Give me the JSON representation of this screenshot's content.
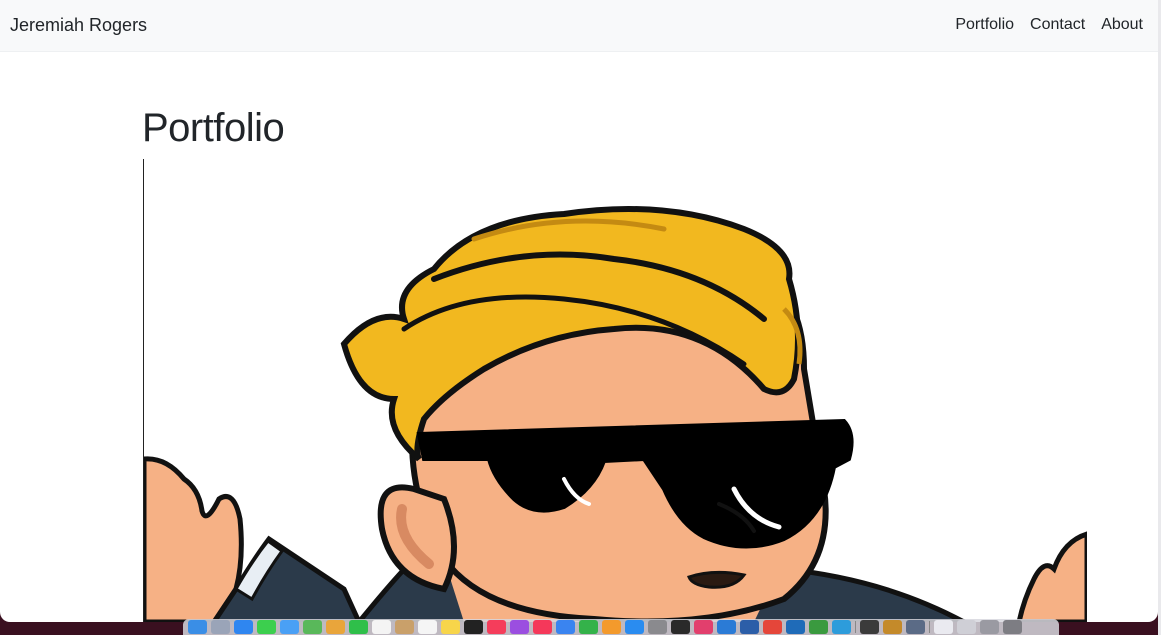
{
  "navbar": {
    "brand": "Jeremiah Rogers",
    "links": [
      {
        "label": "Portfolio"
      },
      {
        "label": "Contact"
      },
      {
        "label": "About"
      }
    ]
  },
  "main": {
    "title": "Portfolio"
  },
  "colors": {
    "navbar_bg": "#f8f9fa",
    "text": "#212529",
    "hair": "#f2b81f",
    "skin": "#f6b185",
    "glasses": "#000000"
  },
  "dock": {
    "icons": [
      {
        "name": "finder-icon",
        "color": "#3a8ee6"
      },
      {
        "name": "launchpad-icon",
        "color": "#9aa4b8"
      },
      {
        "name": "safari-icon",
        "color": "#2f86f0"
      },
      {
        "name": "messages-icon",
        "color": "#3ccf4e"
      },
      {
        "name": "mail-icon",
        "color": "#4aa0f5"
      },
      {
        "name": "maps-icon",
        "color": "#59b85a"
      },
      {
        "name": "photos-icon",
        "color": "#e9a53b"
      },
      {
        "name": "facetime-icon",
        "color": "#2fbf4a"
      },
      {
        "name": "calendar-icon",
        "color": "#f4f4f4"
      },
      {
        "name": "contacts-icon",
        "color": "#c9a06a"
      },
      {
        "name": "reminders-icon",
        "color": "#f5f5f5"
      },
      {
        "name": "notes-icon",
        "color": "#f7d54a"
      },
      {
        "name": "tv-icon",
        "color": "#222222"
      },
      {
        "name": "music-icon",
        "color": "#f53d5b"
      },
      {
        "name": "podcasts-icon",
        "color": "#9b4ee0"
      },
      {
        "name": "news-icon",
        "color": "#f5385a"
      },
      {
        "name": "keynote-icon",
        "color": "#3a84f0"
      },
      {
        "name": "numbers-icon",
        "color": "#34b24a"
      },
      {
        "name": "pages-icon",
        "color": "#f39a2c"
      },
      {
        "name": "app-store-icon",
        "color": "#2a8cf0"
      },
      {
        "name": "system-preferences-icon",
        "color": "#8a8a8e"
      },
      {
        "name": "terminal-icon",
        "color": "#2a2a2a"
      },
      {
        "name": "slack-icon",
        "color": "#e23f6d"
      },
      {
        "name": "vscode-icon",
        "color": "#2b7bd6"
      },
      {
        "name": "sourcetree-icon",
        "color": "#2c5ea8"
      },
      {
        "name": "chrome-icon",
        "color": "#e5463a"
      },
      {
        "name": "wd-icon",
        "color": "#1f6bb8"
      },
      {
        "name": "app-green-icon",
        "color": "#3a9a3f"
      },
      {
        "name": "app-m-icon",
        "color": "#2d9cdb"
      },
      {
        "name": "activity-monitor-icon",
        "color": "#3b3b3b"
      },
      {
        "name": "wow-icon",
        "color": "#c48a2a"
      },
      {
        "name": "screen-icon",
        "color": "#5b6b86"
      },
      {
        "name": "document-icon",
        "color": "#eaeaf0"
      },
      {
        "name": "folder-icon",
        "color": "#cfcfd6"
      },
      {
        "name": "downloads-icon",
        "color": "#9a9aa2"
      },
      {
        "name": "trash-icon",
        "color": "#7d7d83"
      }
    ]
  }
}
